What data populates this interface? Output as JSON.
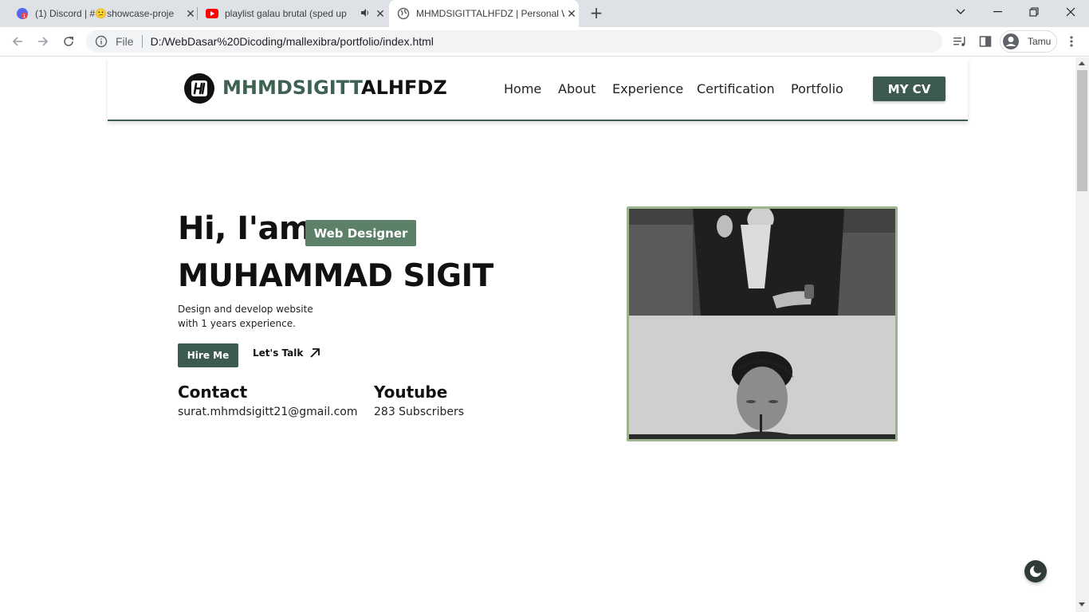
{
  "browser": {
    "tabs": [
      {
        "title": "(1) Discord | #😕showcase-proje",
        "icon": "discord-icon",
        "active": false
      },
      {
        "title": "playlist galau brutal (sped up",
        "icon": "youtube-icon",
        "active": false,
        "audio": "speaker-icon"
      },
      {
        "title": "MHMDSIGITTALHFDZ | Personal W",
        "icon": "globe-icon",
        "active": true
      }
    ],
    "new_tab": "+",
    "address": {
      "scheme_label": "File",
      "url": "D:/WebDasar%20Dicoding/mallexibra/portfolio/index.html"
    },
    "profile_label": "Tamu"
  },
  "site": {
    "brand_part1": "MHMDSIGITT",
    "brand_part2": "ALHFDZ",
    "nav": [
      "Home",
      "About",
      "Experience",
      "Certification",
      "Portfolio"
    ],
    "cv_button": "MY CV",
    "greeting": "Hi, I'am",
    "role_badge": "Web Designer",
    "name": "MUHAMMAD SIGIT",
    "desc_line1": "Design and develop website",
    "desc_line2": "with 1 years experience.",
    "hire_button": "Hire Me",
    "talk_link": "Let's Talk",
    "contact_heading": "Contact",
    "contact_value": "surat.mhmdsigitt21@gmail.com",
    "youtube_heading": "Youtube",
    "youtube_value": "283 Subscribers"
  },
  "colors": {
    "accent": "#3d5a4e",
    "badge": "#5d8069",
    "photo_border": "#9cb58f"
  }
}
